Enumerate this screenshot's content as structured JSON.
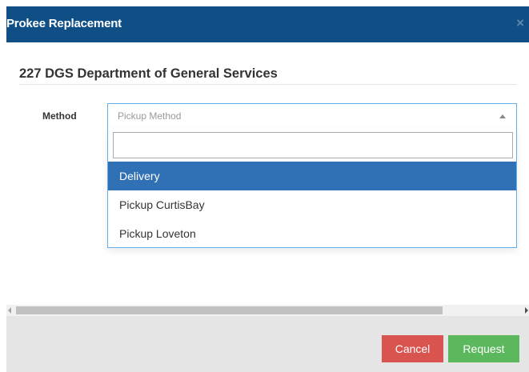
{
  "modal": {
    "title": "Prokee Replacement",
    "close_glyph": "×"
  },
  "section": {
    "title": "227 DGS Department of General Services"
  },
  "method_field": {
    "label": "Method",
    "placeholder": "Pickup Method",
    "search_value": "",
    "options": [
      {
        "label": "Delivery",
        "highlighted": true
      },
      {
        "label": "Pickup CurtisBay",
        "highlighted": false
      },
      {
        "label": "Pickup Loveton",
        "highlighted": false
      }
    ]
  },
  "footer": {
    "cancel_label": "Cancel",
    "request_label": "Request"
  },
  "colors": {
    "header_bg": "#0f4f86",
    "highlight": "#3071b5",
    "cancel": "#d9534f",
    "request": "#5cb85c"
  }
}
